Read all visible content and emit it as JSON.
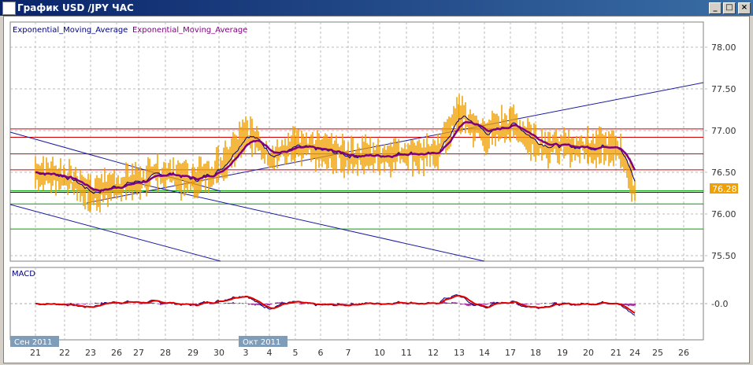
{
  "window": {
    "title": "График USD /JPY  ЧАС",
    "buttons": [
      "_",
      "□",
      "×"
    ]
  },
  "legend": {
    "ema1": "Exponential_Moving_Average",
    "ema2": "Exponential_Moving_Average",
    "macd": "MACD"
  },
  "colors": {
    "price": "#f0a000",
    "ema_fast": "#000080",
    "ema_slow": "#800080",
    "macd_signal": "#e00000",
    "support": "#00a000",
    "resistance": "#d00000",
    "trend": "#1a1aa0"
  },
  "price_axis": [
    "78.00",
    "77.50",
    "77.00",
    "76.50",
    "76.00",
    "75.50"
  ],
  "macd_axis": "-0.0",
  "current_price": "76.28",
  "month_labels": [
    "Сен 2011",
    "Окт 2011"
  ],
  "date_labels": [
    "21",
    "22",
    "23",
    "26",
    "27",
    "28",
    "29",
    "30",
    "3",
    "4",
    "5",
    "6",
    "7",
    "10",
    "11",
    "12",
    "13",
    "14",
    "17",
    "18",
    "19",
    "20",
    "21",
    "24",
    "25",
    "26"
  ],
  "chart_data": {
    "type": "line",
    "title": "USD/JPY 1H",
    "x": [
      "21",
      "22",
      "23",
      "26",
      "27",
      "28",
      "29",
      "30",
      "3",
      "4",
      "5",
      "6",
      "7",
      "10",
      "11",
      "12",
      "13",
      "14",
      "17",
      "18",
      "19",
      "20",
      "21",
      "24"
    ],
    "close": [
      76.5,
      76.45,
      76.25,
      76.35,
      76.4,
      76.5,
      76.4,
      76.55,
      77.0,
      76.7,
      76.8,
      76.75,
      76.7,
      76.7,
      76.75,
      76.7,
      77.2,
      76.95,
      77.1,
      76.85,
      76.8,
      76.8,
      76.85,
      76.28
    ],
    "ylim": [
      75.4,
      78.2
    ],
    "horizontal_levels": {
      "resistance": [
        77.02,
        76.92,
        76.72,
        76.53
      ],
      "support": [
        76.28,
        76.12,
        75.82
      ]
    }
  }
}
